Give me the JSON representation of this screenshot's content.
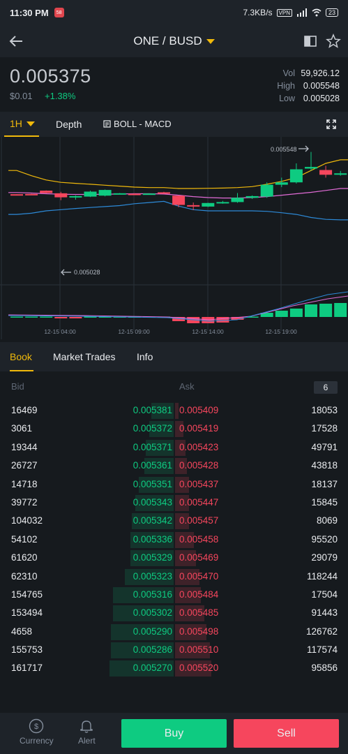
{
  "status_bar": {
    "time": "11:30 PM",
    "notification_badge": "58",
    "network_speed": "7.3KB/s",
    "vpn": "VPN",
    "battery": "23"
  },
  "nav": {
    "pair": "ONE / BUSD",
    "icons": [
      "back-arrow-icon",
      "split-view-icon",
      "star-icon"
    ]
  },
  "ticker": {
    "last_price": "0.005375",
    "fiat_price": "$0.01",
    "change": "+1.38%",
    "vol_label": "Vol",
    "vol_value": "59,926.12",
    "high_label": "High",
    "high_value": "0.005548",
    "low_label": "Low",
    "low_value": "0.005028"
  },
  "chart_tabs": {
    "timeframe": "1H",
    "depth": "Depth",
    "indicators": "BOLL - MACD"
  },
  "chart": {
    "high_marker": "0.005548",
    "low_marker": "0.005028",
    "x_ticks": [
      "12-15 04:00",
      "12-15 09:00",
      "12-15 14:00",
      "12-15 19:00"
    ]
  },
  "chart_data": {
    "type": "candlestick",
    "candles": [
      {
        "o": 0.00537,
        "h": 0.00537,
        "l": 0.005366,
        "c": 0.005368
      },
      {
        "o": 0.005371,
        "h": 0.005372,
        "l": 0.005368,
        "c": 0.00537
      },
      {
        "o": 0.005385,
        "h": 0.005386,
        "l": 0.005374,
        "c": 0.005375
      },
      {
        "o": 0.005374,
        "h": 0.00538,
        "l": 0.005345,
        "c": 0.005357
      },
      {
        "o": 0.005358,
        "h": 0.005365,
        "l": 0.005347,
        "c": 0.005362
      },
      {
        "o": 0.00536,
        "h": 0.005385,
        "l": 0.005358,
        "c": 0.005381
      },
      {
        "o": 0.005364,
        "h": 0.00539,
        "l": 0.005361,
        "c": 0.005388
      },
      {
        "o": 0.005374,
        "h": 0.005375,
        "l": 0.005373,
        "c": 0.005374
      },
      {
        "o": 0.005372,
        "h": 0.005374,
        "l": 0.005368,
        "c": 0.005369
      },
      {
        "o": 0.005372,
        "h": 0.005374,
        "l": 0.00537,
        "c": 0.005373
      },
      {
        "o": 0.005378,
        "h": 0.00538,
        "l": 0.005373,
        "c": 0.005374
      },
      {
        "o": 0.005364,
        "h": 0.005365,
        "l": 0.005315,
        "c": 0.005325
      },
      {
        "o": 0.005324,
        "h": 0.005335,
        "l": 0.005303,
        "c": 0.005318
      },
      {
        "o": 0.005318,
        "h": 0.005334,
        "l": 0.005316,
        "c": 0.005333
      },
      {
        "o": 0.005333,
        "h": 0.005342,
        "l": 0.00533,
        "c": 0.005337
      },
      {
        "o": 0.005337,
        "h": 0.005375,
        "l": 0.005334,
        "c": 0.005355
      },
      {
        "o": 0.005355,
        "h": 0.005365,
        "l": 0.00535,
        "c": 0.005362
      },
      {
        "o": 0.00536,
        "h": 0.00542,
        "l": 0.005355,
        "c": 0.00541
      },
      {
        "o": 0.00541,
        "h": 0.00544,
        "l": 0.0054,
        "c": 0.00542
      },
      {
        "o": 0.00542,
        "h": 0.0055,
        "l": 0.005415,
        "c": 0.005475
      },
      {
        "o": 0.005478,
        "h": 0.005548,
        "l": 0.00547,
        "c": 0.005485
      },
      {
        "o": 0.005472,
        "h": 0.00549,
        "l": 0.00544,
        "c": 0.005452
      },
      {
        "o": 0.005452,
        "h": 0.005468,
        "l": 0.005448,
        "c": 0.005458
      }
    ],
    "boll_upper": [
      0.00547,
      0.005448,
      0.00543,
      0.00542,
      0.005416,
      0.005412,
      0.005408,
      0.005404,
      0.0054,
      0.005398,
      0.005398,
      0.005394,
      0.005394,
      0.005395,
      0.005396,
      0.005398,
      0.005402,
      0.005412,
      0.005424,
      0.00544,
      0.00547,
      0.0055,
      0.005515
    ],
    "boll_mid": [
      0.005377,
      0.005375,
      0.005372,
      0.00537,
      0.005369,
      0.005369,
      0.00537,
      0.005371,
      0.005372,
      0.005372,
      0.005371,
      0.005366,
      0.00536,
      0.005356,
      0.005354,
      0.005354,
      0.005356,
      0.00536,
      0.005366,
      0.005372,
      0.005378,
      0.005386,
      0.005394
    ],
    "boll_lower": [
      0.005285,
      0.00529,
      0.0053,
      0.005305,
      0.00531,
      0.005314,
      0.005318,
      0.005322,
      0.00533,
      0.005335,
      0.00534,
      0.00532,
      0.005305,
      0.0053,
      0.0053,
      0.0053,
      0.0053,
      0.005298,
      0.005292,
      0.005285,
      0.005272,
      0.005264,
      0.005262
    ],
    "macd_hist": [
      0.0,
      0.0,
      0.0,
      -0.1,
      -0.1,
      0.0,
      0.0,
      0.0,
      0.0,
      0.0,
      0.0,
      -0.3,
      -0.45,
      -0.45,
      -0.4,
      -0.2,
      0.0,
      0.3,
      0.45,
      0.6,
      0.9,
      0.95,
      1.0
    ]
  },
  "book_tabs": [
    "Book",
    "Market Trades",
    "Info"
  ],
  "book": {
    "bid_header": "Bid",
    "ask_header": "Ask",
    "depth_selector": "6",
    "rows": [
      {
        "bid_qty": "16469",
        "bid_price": "0.005381",
        "ask_price": "0.005409",
        "ask_qty": "18053"
      },
      {
        "bid_qty": "3061",
        "bid_price": "0.005372",
        "ask_price": "0.005419",
        "ask_qty": "17528"
      },
      {
        "bid_qty": "19344",
        "bid_price": "0.005371",
        "ask_price": "0.005423",
        "ask_qty": "49791"
      },
      {
        "bid_qty": "26727",
        "bid_price": "0.005361",
        "ask_price": "0.005428",
        "ask_qty": "43818"
      },
      {
        "bid_qty": "14718",
        "bid_price": "0.005351",
        "ask_price": "0.005437",
        "ask_qty": "18137"
      },
      {
        "bid_qty": "39772",
        "bid_price": "0.005343",
        "ask_price": "0.005447",
        "ask_qty": "15845"
      },
      {
        "bid_qty": "104032",
        "bid_price": "0.005342",
        "ask_price": "0.005457",
        "ask_qty": "8069"
      },
      {
        "bid_qty": "54102",
        "bid_price": "0.005336",
        "ask_price": "0.005458",
        "ask_qty": "95520"
      },
      {
        "bid_qty": "61620",
        "bid_price": "0.005329",
        "ask_price": "0.005469",
        "ask_qty": "29079"
      },
      {
        "bid_qty": "62310",
        "bid_price": "0.005323",
        "ask_price": "0.005470",
        "ask_qty": "118244"
      },
      {
        "bid_qty": "154765",
        "bid_price": "0.005316",
        "ask_price": "0.005484",
        "ask_qty": "17504"
      },
      {
        "bid_qty": "153494",
        "bid_price": "0.005302",
        "ask_price": "0.005485",
        "ask_qty": "91443"
      },
      {
        "bid_qty": "4658",
        "bid_price": "0.005290",
        "ask_price": "0.005498",
        "ask_qty": "126762"
      },
      {
        "bid_qty": "155753",
        "bid_price": "0.005286",
        "ask_price": "0.005510",
        "ask_qty": "117574"
      },
      {
        "bid_qty": "161717",
        "bid_price": "0.005270",
        "ask_price": "0.005520",
        "ask_qty": "95856"
      }
    ]
  },
  "bottom_bar": {
    "currency_label": "Currency",
    "alert_label": "Alert",
    "buy_label": "Buy",
    "sell_label": "Sell"
  },
  "colors": {
    "up": "#0ecb81",
    "down": "#f6465d",
    "accent": "#f0b90b",
    "boll_upper": "#f0b90b",
    "boll_mid": "#e16bd6",
    "boll_lower": "#2d8ad8"
  }
}
